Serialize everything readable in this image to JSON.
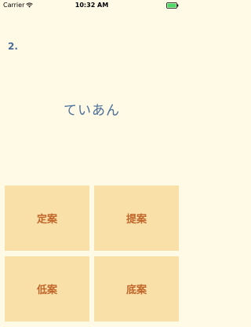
{
  "status_bar": {
    "carrier": "Carrier",
    "time": "10:32 AM",
    "icons": [
      "wifi-icon",
      "battery-icon"
    ],
    "battery_level": 1.0
  },
  "quiz": {
    "question_number": "2.",
    "question_text": "ていあん",
    "answers": [
      "定案",
      "提案",
      "低案",
      "底案"
    ]
  },
  "colors": {
    "background": "#FFFAE6",
    "question_text": "#4A6E9A",
    "answer_background": "#F9E0A8",
    "answer_text": "#C0662A",
    "battery_fill": "#4CD964"
  }
}
